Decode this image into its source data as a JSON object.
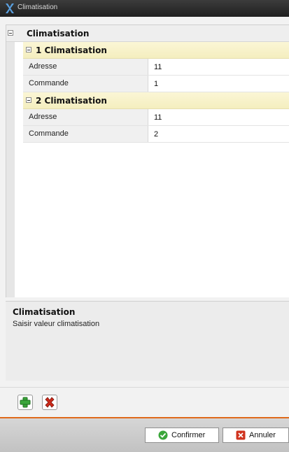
{
  "window": {
    "title": "Climatisation"
  },
  "grid": {
    "root": {
      "label": "Climatisation"
    },
    "groups": [
      {
        "label": "1 Climatisation",
        "props": [
          {
            "key": "Adresse",
            "value": "11"
          },
          {
            "key": "Commande",
            "value": "1"
          }
        ]
      },
      {
        "label": "2 Climatisation",
        "props": [
          {
            "key": "Adresse",
            "value": "11"
          },
          {
            "key": "Commande",
            "value": "2"
          }
        ]
      }
    ]
  },
  "description": {
    "title": "Climatisation",
    "text": "Saisir valeur climatisation"
  },
  "toolbar": {
    "add_icon": "plus-icon",
    "delete_icon": "x-icon"
  },
  "footer": {
    "confirm_label": "Confirmer",
    "cancel_label": "Annuler"
  },
  "colors": {
    "accent_line": "#e06a1a",
    "category_bg": "#f4eebf",
    "add_green": "#3aa63a",
    "delete_red": "#cc2a1a"
  }
}
